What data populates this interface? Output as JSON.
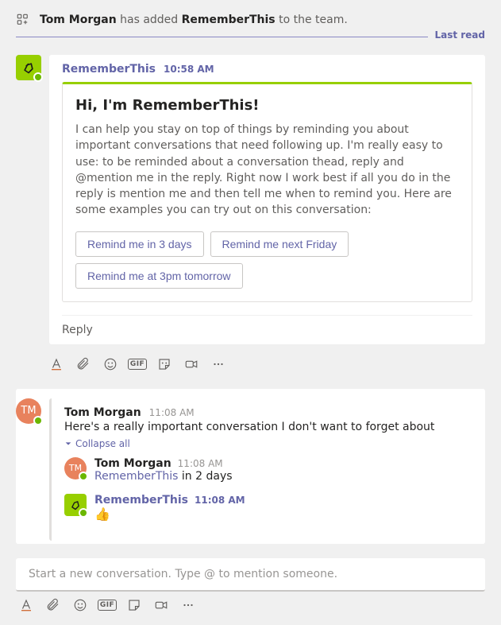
{
  "system": {
    "actor": "Tom Morgan",
    "middle": " has added ",
    "target": "RememberThis",
    "suffix": " to the team."
  },
  "lastRead": "Last read",
  "botMessage": {
    "sender": "RememberThis",
    "time": "10:58 AM",
    "card": {
      "title": "Hi, I'm RememberThis!",
      "body": "I can help you stay on top of things by reminding you about important conversations that need following up. I'm really easy to use: to be reminded about a conversation thead, reply and @mention me in the reply. Right now I work best if all you do in the reply is mention me and then tell me when to remind you. Here are some examples you can try out on this conversation:",
      "buttons": [
        "Remind me in 3 days",
        "Remind me next Friday",
        "Remind me at 3pm tomorrow"
      ]
    },
    "replyLabel": "Reply"
  },
  "thread": {
    "sender": "Tom Morgan",
    "initials": "TM",
    "time": "11:08 AM",
    "text": "Here's a really important conversation I don't want to forget about",
    "collapse": "Collapse all",
    "replies": [
      {
        "sender": "Tom Morgan",
        "initials": "TM",
        "time": "11:08 AM",
        "mention": "RememberThis",
        "text": " in 2 days"
      },
      {
        "sender": "RememberThis",
        "time": "11:08 AM",
        "emoji": "👍"
      }
    ]
  },
  "compose": {
    "placeholder": "Start a new conversation. Type @ to mention someone."
  }
}
